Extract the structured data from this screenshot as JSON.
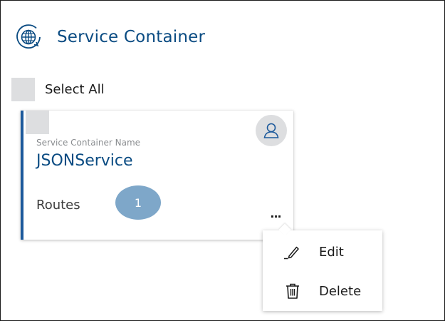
{
  "header": {
    "title": "Service Container",
    "icon": "globe-icon"
  },
  "select_all": {
    "label": "Select All",
    "checked": false
  },
  "card": {
    "field_label": "Service Container Name",
    "service_name": "JSONService",
    "routes_label": "Routes",
    "routes_count": "1",
    "more_label": "...",
    "avatar_icon": "user-icon",
    "accent_color": "#1d5a9c"
  },
  "context_menu": {
    "items": [
      {
        "label": "Edit",
        "icon": "pencil-icon"
      },
      {
        "label": "Delete",
        "icon": "trash-icon"
      }
    ]
  },
  "colors": {
    "title": "#0a4b82",
    "badge": "#7ea7c9",
    "checkbox": "#dddee0"
  }
}
